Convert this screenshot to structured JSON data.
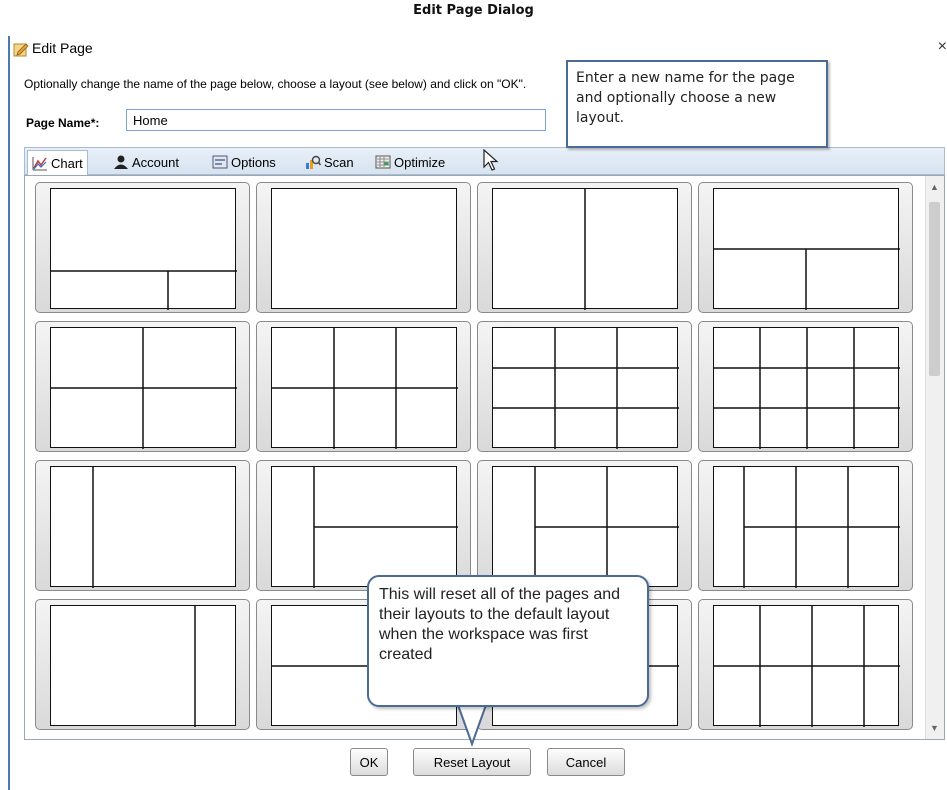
{
  "caption": "Edit Page Dialog",
  "window": {
    "title": "Edit Page",
    "close_glyph": "×",
    "app_icon": "edit-page-icon"
  },
  "instructions": "Optionally change the name of the page below, choose a layout (see below) and click on \"OK\".",
  "page_name": {
    "label": "Page Name*:",
    "value": "Home"
  },
  "tabs": [
    {
      "label": "Chart",
      "icon": "chart-icon",
      "active": true
    },
    {
      "label": "Account",
      "icon": "account-icon",
      "active": false
    },
    {
      "label": "Options",
      "icon": "options-icon",
      "active": false
    },
    {
      "label": "Scan",
      "icon": "scan-icon",
      "active": false
    },
    {
      "label": "Optimize",
      "icon": "optimize-icon",
      "active": false
    }
  ],
  "buttons": {
    "ok": "OK",
    "reset": "Reset Layout",
    "cancel": "Cancel"
  },
  "callouts": {
    "name_tip": "Enter a new name for the page and optionally choose a new layout.",
    "reset_tip": "This will reset all of the pages and their layouts to the default layout when the workspace was first created"
  },
  "colors": {
    "accent": "#4a7ab0",
    "callout_border": "#4b6a94",
    "tab_bar": "#d7e3f0"
  }
}
